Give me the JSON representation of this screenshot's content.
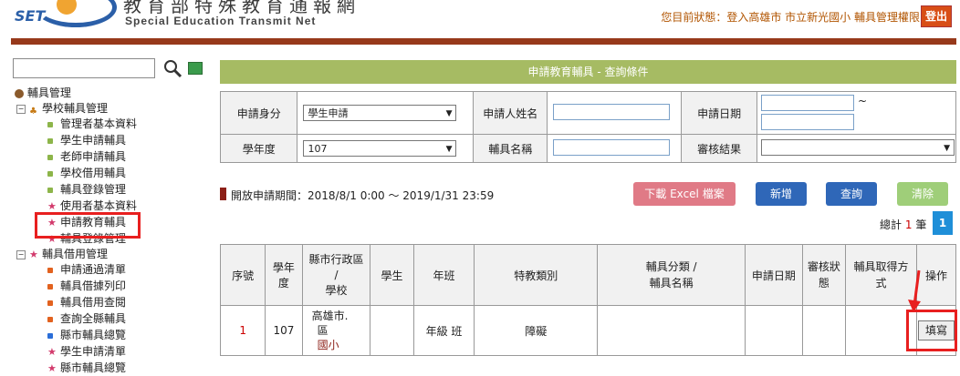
{
  "header": {
    "logo_text": "SET",
    "site_title": "教育部特殊教育通報網",
    "site_subtitle": "Special Education Transmit Net",
    "status": "您目前狀態：登入高雄市 市立新光國小 輔具管理權限",
    "logout": "登出"
  },
  "sidebar": {
    "search_placeholder": "",
    "root": "輔具管理",
    "group1": "學校輔具管理",
    "group1_items": [
      "管理者基本資料",
      "學生申請輔具",
      "老師申請輔具",
      "學校借用輔具",
      "輔具登錄管理",
      "使用者基本資料",
      "申請教育輔具",
      "輔具登錄管理"
    ],
    "group2": "輔具借用管理",
    "group2_items": [
      "申請通過清單",
      "輔具借據列印",
      "輔具借用查閱",
      "查詢全縣輔具",
      "縣市輔具總覽",
      "學生申請清單",
      "縣市輔具總覽"
    ]
  },
  "panel": {
    "title": "申請教育輔具 - 查詢條件"
  },
  "query": {
    "applicant_type_label": "申請身分",
    "applicant_type_value": "學生申請",
    "applicant_name_label": "申請人姓名",
    "apply_date_label": "申請日期",
    "date_sep": "~",
    "school_year_label": "學年度",
    "school_year_value": "107",
    "aid_name_label": "輔具名稱",
    "review_label": "審核結果",
    "review_value": ""
  },
  "period": {
    "label": "開放申請期間：2018/8/1 0:00 ～ 2019/1/31 23:59"
  },
  "buttons": {
    "excel": "下載 Excel 檔案",
    "add": "新增",
    "search": "查詢",
    "clear": "清除"
  },
  "pager": {
    "total_prefix": "總計",
    "total_count": "1",
    "total_suffix": "筆",
    "page": "1"
  },
  "results": {
    "headers": [
      "序號",
      "學年度",
      "縣市行政區\n/\n學校",
      "學生",
      "年班",
      "特教類別",
      "輔具分類 /\n輔具名稱",
      "申請日期",
      "審核狀態",
      "輔具取得方式",
      "操作"
    ],
    "row": {
      "no": "1",
      "year": "107",
      "city": "高雄市.",
      "district": "區",
      "school": "國小",
      "student": "",
      "grade": "年級  班",
      "category": "障礙",
      "aid": "",
      "date": "",
      "review": "",
      "method": "",
      "action": "填寫"
    }
  },
  "colors": {
    "accent_bar": "#97391b",
    "panel_green": "#a6bb63",
    "excel_btn": "#e07a86",
    "blue_btn": "#2f67b8",
    "clear_btn": "#9fce79",
    "highlight": "#e81f1f"
  }
}
